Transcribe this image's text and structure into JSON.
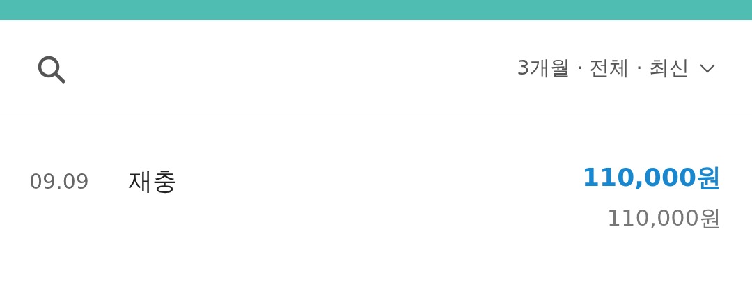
{
  "filter": {
    "label": "3개월 · 전체 · 최신"
  },
  "transactions": [
    {
      "date": "09.09",
      "title": "재충",
      "amount": "110,000원",
      "balance": "110,000원"
    }
  ]
}
